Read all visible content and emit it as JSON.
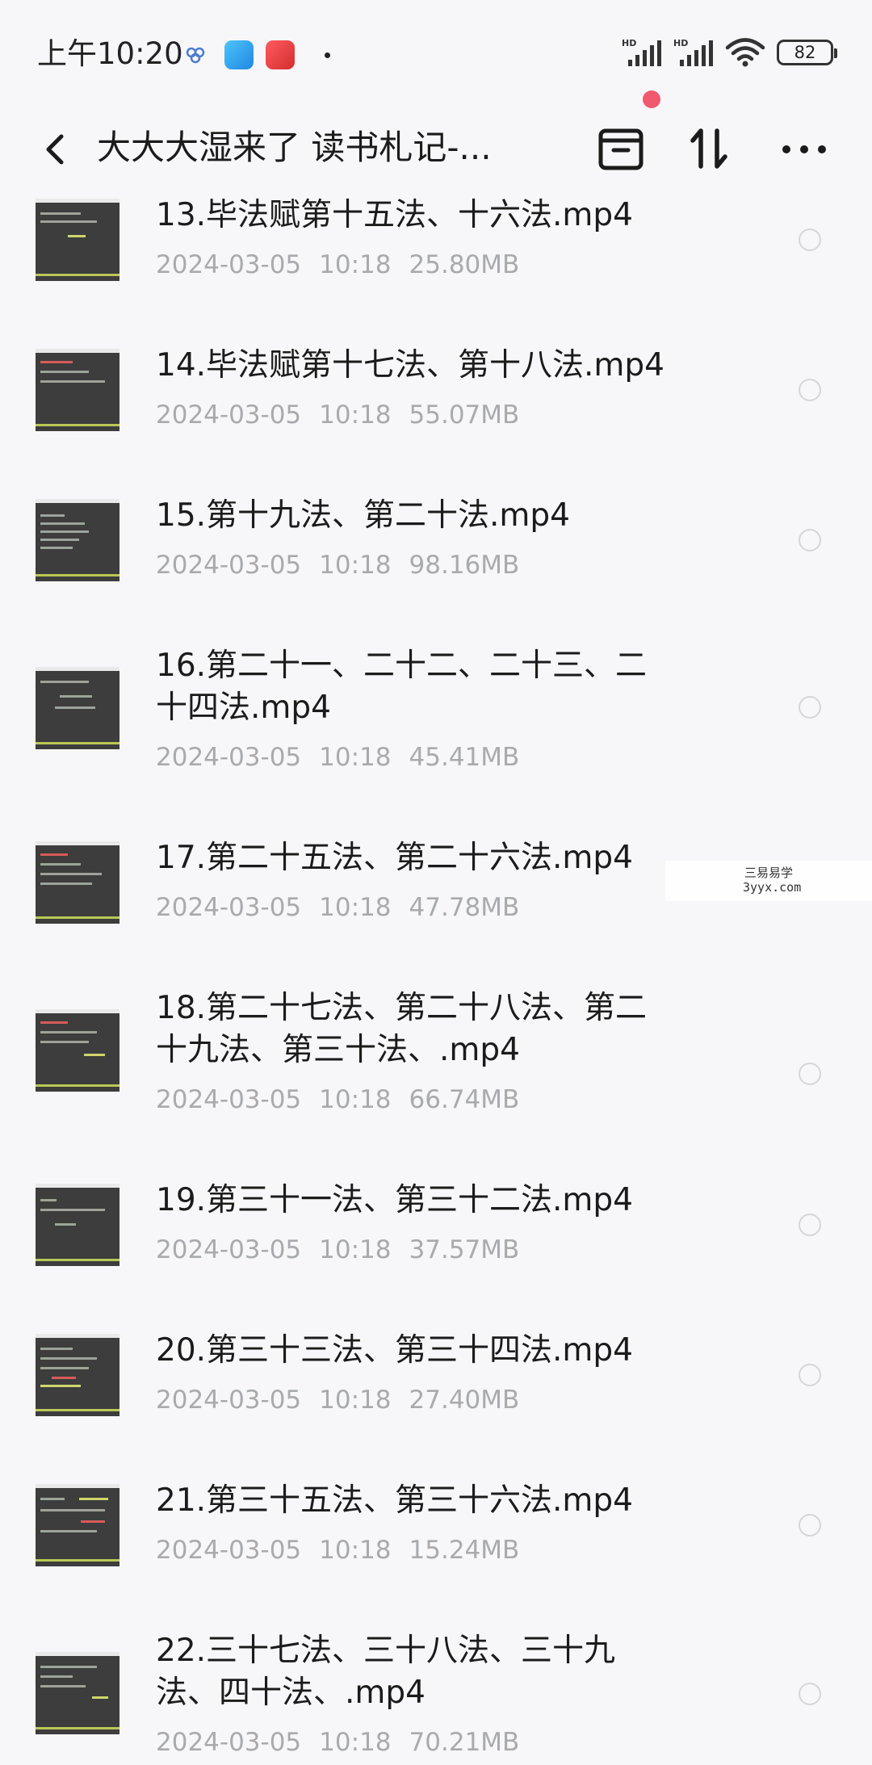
{
  "status_bar": {
    "time": "上午10:20",
    "battery": "82",
    "signal_label_1": "HD",
    "signal_label_2": "HD"
  },
  "header": {
    "title": "大大大湿来了 读书札记-...",
    "icons": [
      "back-arrow-icon",
      "archive-box-icon",
      "sort-arrows-icon",
      "more-dots-icon"
    ],
    "notification_dot_color": "#f0596e"
  },
  "files": [
    {
      "name": "13.毕法赋第十五法、十六法.mp4",
      "date": "2024-03-05",
      "time": "10:18",
      "size": "25.80MB"
    },
    {
      "name": "14.毕法赋第十七法、第十八法.mp4",
      "date": "2024-03-05",
      "time": "10:18",
      "size": "55.07MB"
    },
    {
      "name": "15.第十九法、第二十法.mp4",
      "date": "2024-03-05",
      "time": "10:18",
      "size": "98.16MB"
    },
    {
      "name": "16.第二十一、二十二、二十三、二十四法.mp4",
      "date": "2024-03-05",
      "time": "10:18",
      "size": "45.41MB"
    },
    {
      "name": "17.第二十五法、第二十六法.mp4",
      "date": "2024-03-05",
      "time": "10:18",
      "size": "47.78MB"
    },
    {
      "name": "18.第二十七法、第二十八法、第二十九法、第三十法、.mp4",
      "date": "2024-03-05",
      "time": "10:18",
      "size": "66.74MB"
    },
    {
      "name": "19.第三十一法、第三十二法.mp4",
      "date": "2024-03-05",
      "time": "10:18",
      "size": "37.57MB"
    },
    {
      "name": "20.第三十三法、第三十四法.mp4",
      "date": "2024-03-05",
      "time": "10:18",
      "size": "27.40MB"
    },
    {
      "name": "21.第三十五法、第三十六法.mp4",
      "date": "2024-03-05",
      "time": "10:18",
      "size": "15.24MB"
    },
    {
      "name": "22.三十七法、三十八法、三十九法、四十法、.mp4",
      "date": "2024-03-05",
      "time": "10:18",
      "size": "70.21MB"
    }
  ],
  "watermark": {
    "line1": "三易易学",
    "line2": "3yyx.com"
  }
}
